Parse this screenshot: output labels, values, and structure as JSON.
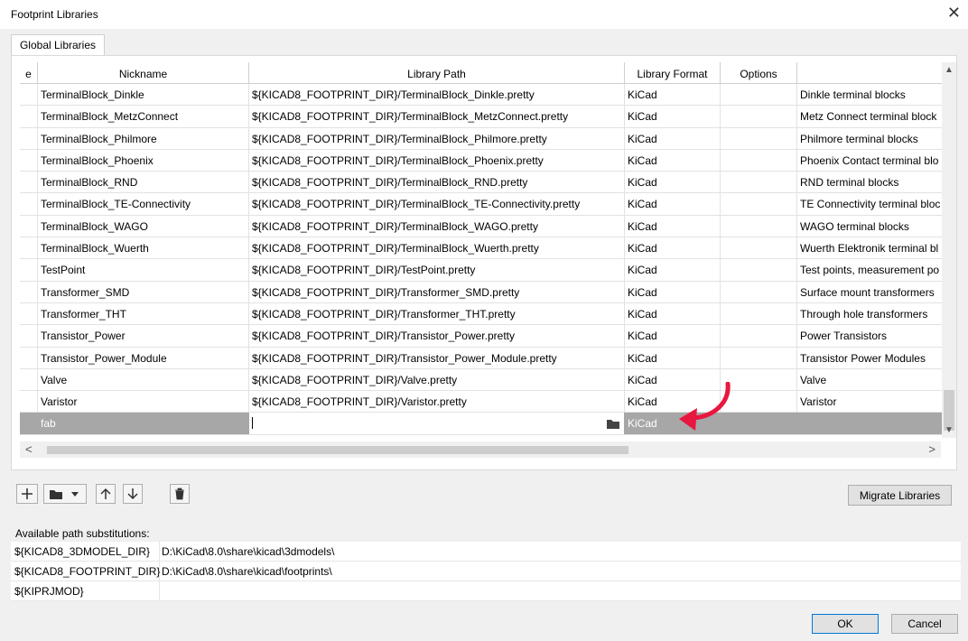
{
  "window": {
    "title": "Footprint Libraries",
    "close_glyph": "✕"
  },
  "tabs": [
    {
      "label": "Global Libraries"
    }
  ],
  "table": {
    "columns": [
      "e",
      "Nickname",
      "Library Path",
      "Library Format",
      "Options",
      ""
    ],
    "rows": [
      {
        "nickname": "TerminalBlock_Dinkle",
        "path": "${KICAD8_FOOTPRINT_DIR}/TerminalBlock_Dinkle.pretty",
        "format": "KiCad",
        "options": "",
        "description": "Dinkle terminal blocks"
      },
      {
        "nickname": "TerminalBlock_MetzConnect",
        "path": "${KICAD8_FOOTPRINT_DIR}/TerminalBlock_MetzConnect.pretty",
        "format": "KiCad",
        "options": "",
        "description": "Metz Connect terminal block"
      },
      {
        "nickname": "TerminalBlock_Philmore",
        "path": "${KICAD8_FOOTPRINT_DIR}/TerminalBlock_Philmore.pretty",
        "format": "KiCad",
        "options": "",
        "description": "Philmore terminal blocks"
      },
      {
        "nickname": "TerminalBlock_Phoenix",
        "path": "${KICAD8_FOOTPRINT_DIR}/TerminalBlock_Phoenix.pretty",
        "format": "KiCad",
        "options": "",
        "description": "Phoenix Contact terminal blo"
      },
      {
        "nickname": "TerminalBlock_RND",
        "path": "${KICAD8_FOOTPRINT_DIR}/TerminalBlock_RND.pretty",
        "format": "KiCad",
        "options": "",
        "description": "RND terminal blocks"
      },
      {
        "nickname": "TerminalBlock_TE-Connectivity",
        "path": "${KICAD8_FOOTPRINT_DIR}/TerminalBlock_TE-Connectivity.pretty",
        "format": "KiCad",
        "options": "",
        "description": "TE Connectivity terminal bloc"
      },
      {
        "nickname": "TerminalBlock_WAGO",
        "path": "${KICAD8_FOOTPRINT_DIR}/TerminalBlock_WAGO.pretty",
        "format": "KiCad",
        "options": "",
        "description": "WAGO terminal blocks"
      },
      {
        "nickname": "TerminalBlock_Wuerth",
        "path": "${KICAD8_FOOTPRINT_DIR}/TerminalBlock_Wuerth.pretty",
        "format": "KiCad",
        "options": "",
        "description": "Wuerth Elektronik terminal bl"
      },
      {
        "nickname": "TestPoint",
        "path": "${KICAD8_FOOTPRINT_DIR}/TestPoint.pretty",
        "format": "KiCad",
        "options": "",
        "description": "Test points, measurement po"
      },
      {
        "nickname": "Transformer_SMD",
        "path": "${KICAD8_FOOTPRINT_DIR}/Transformer_SMD.pretty",
        "format": "KiCad",
        "options": "",
        "description": "Surface mount transformers"
      },
      {
        "nickname": "Transformer_THT",
        "path": "${KICAD8_FOOTPRINT_DIR}/Transformer_THT.pretty",
        "format": "KiCad",
        "options": "",
        "description": "Through hole transformers"
      },
      {
        "nickname": "Transistor_Power",
        "path": "${KICAD8_FOOTPRINT_DIR}/Transistor_Power.pretty",
        "format": "KiCad",
        "options": "",
        "description": "Power Transistors"
      },
      {
        "nickname": "Transistor_Power_Module",
        "path": "${KICAD8_FOOTPRINT_DIR}/Transistor_Power_Module.pretty",
        "format": "KiCad",
        "options": "",
        "description": "Transistor Power Modules"
      },
      {
        "nickname": "Valve",
        "path": "${KICAD8_FOOTPRINT_DIR}/Valve.pretty",
        "format": "KiCad",
        "options": "",
        "description": "Valve"
      },
      {
        "nickname": "Varistor",
        "path": "${KICAD8_FOOTPRINT_DIR}/Varistor.pretty",
        "format": "KiCad",
        "options": "",
        "description": "Varistor"
      }
    ],
    "new_row": {
      "nickname": "fab",
      "path": "",
      "format": "KiCad",
      "options": "",
      "description": ""
    }
  },
  "toolbar": {
    "add_icon": "plus-icon",
    "browse_icon": "folder-icon",
    "dropdown_icon": "chevron-down-icon",
    "move_up_icon": "arrow-up-icon",
    "move_down_icon": "arrow-down-icon",
    "delete_icon": "trash-icon",
    "migrate_label": "Migrate Libraries"
  },
  "substitutions": {
    "label": "Available path substitutions:",
    "items": [
      {
        "name": "${KICAD8_3DMODEL_DIR}",
        "value": "D:\\KiCad\\8.0\\share\\kicad\\3dmodels\\"
      },
      {
        "name": "${KICAD8_FOOTPRINT_DIR}",
        "value": "D:\\KiCad\\8.0\\share\\kicad\\footprints\\"
      },
      {
        "name": "${KIPRJMOD}",
        "value": ""
      }
    ]
  },
  "buttons": {
    "ok": "OK",
    "cancel": "Cancel"
  },
  "colors": {
    "selected_row": "#a7a7a7",
    "annotation_arrow": "#e8173f",
    "ok_border": "#0078d7"
  }
}
